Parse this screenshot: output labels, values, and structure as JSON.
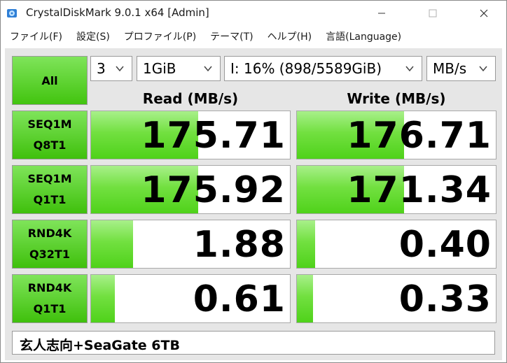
{
  "window": {
    "title": "CrystalDiskMark 9.0.1 x64 [Admin]"
  },
  "menu": [
    "ファイル(F)",
    "設定(S)",
    "プロファイル(P)",
    "テーマ(T)",
    "ヘルプ(H)",
    "言語(Language)"
  ],
  "controls": {
    "all_label": "All",
    "count": "3",
    "size": "1GiB",
    "drive": "I: 16% (898/5589GiB)",
    "unit": "MB/s"
  },
  "headers": {
    "read": "Read (MB/s)",
    "write": "Write (MB/s)"
  },
  "tests": [
    {
      "line1": "SEQ1M",
      "line2": "Q8T1",
      "read": "175.71",
      "write": "176.71",
      "read_fill": 0.54,
      "write_fill": 0.54
    },
    {
      "line1": "SEQ1M",
      "line2": "Q1T1",
      "read": "175.92",
      "write": "171.34",
      "read_fill": 0.54,
      "write_fill": 0.54
    },
    {
      "line1": "RND4K",
      "line2": "Q32T1",
      "read": "1.88",
      "write": "0.40",
      "read_fill": 0.21,
      "write_fill": 0.09
    },
    {
      "line1": "RND4K",
      "line2": "Q1T1",
      "read": "0.61",
      "write": "0.33",
      "read_fill": 0.12,
      "write_fill": 0.08
    }
  ],
  "comment": "玄人志向+SeaGate 6TB",
  "icons": {
    "app": "crystaldiskmark-app-icon",
    "minimize": "minimize-icon",
    "maximize": "maximize-icon",
    "close": "close-icon",
    "dropdown": "chevron-down-icon"
  }
}
